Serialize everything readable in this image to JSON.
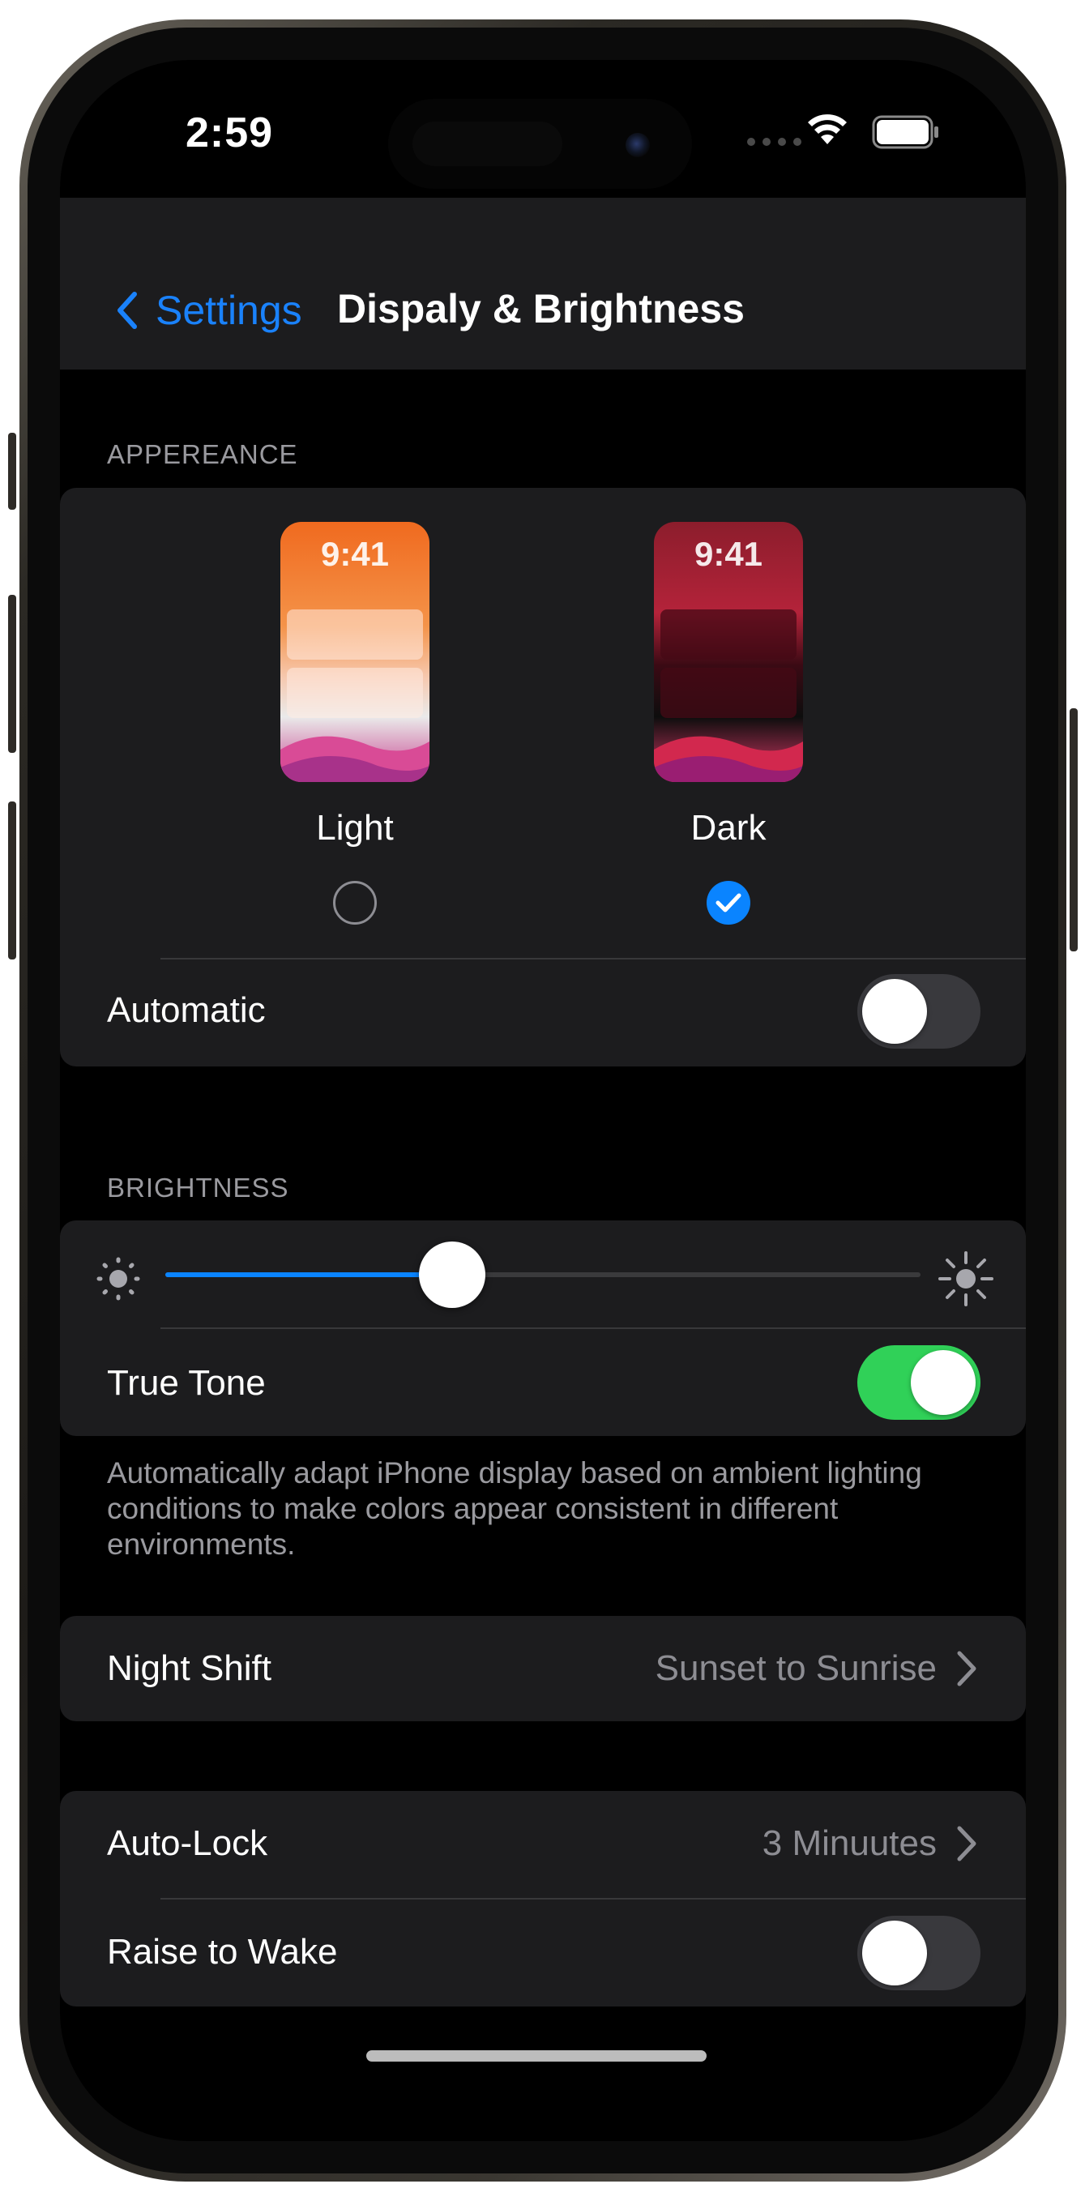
{
  "status_bar": {
    "time": "2:59"
  },
  "navbar": {
    "back_label": "Settings",
    "title": "Dispaly & Brightness"
  },
  "appearance": {
    "header": "APPEREANCE",
    "options": [
      {
        "label": "Light",
        "preview_time": "9:41",
        "selected": false
      },
      {
        "label": "Dark",
        "preview_time": "9:41",
        "selected": true
      }
    ],
    "automatic": {
      "label": "Automatic",
      "on": false
    }
  },
  "brightness": {
    "header": "BRIGHTNESS",
    "level": 0.38,
    "true_tone": {
      "label": "True Tone",
      "on": true
    },
    "footer": "Automatically adapt iPhone display based on ambient lighting conditions to make colors appear consistent in different environments."
  },
  "night_shift": {
    "label": "Night Shift",
    "value": "Sunset to Sunrise"
  },
  "lock": {
    "auto_lock": {
      "label": "Auto-Lock",
      "value": "3 Minuutes"
    },
    "raise_to_wake": {
      "label": "Raise to Wake",
      "on": false
    }
  },
  "colors": {
    "accent": "#0a84ff",
    "toggle_on": "#30d158",
    "background": "#000000",
    "group_background": "#1c1c1e",
    "secondary_text": "#8d8d93"
  },
  "icons": [
    "chevron-left-icon",
    "wifi-icon",
    "battery-icon",
    "checkmark-icon",
    "sun-dim-icon",
    "sun-bright-icon",
    "chevron-right-icon"
  ]
}
